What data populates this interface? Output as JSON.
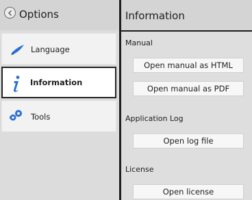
{
  "sidebar": {
    "title": "Options",
    "items": [
      {
        "label": "Language",
        "icon": "brush-icon",
        "selected": false
      },
      {
        "label": "Information",
        "icon": "info-icon",
        "selected": true
      },
      {
        "label": "Tools",
        "icon": "tools-icon",
        "selected": false
      }
    ]
  },
  "content": {
    "title": "Information",
    "sections": [
      {
        "label": "Manual",
        "buttons": [
          "Open manual as HTML",
          "Open manual as PDF"
        ]
      },
      {
        "label": "Application Log",
        "buttons": [
          "Open log file"
        ]
      },
      {
        "label": "License",
        "buttons": [
          "Open license"
        ]
      }
    ]
  },
  "colors": {
    "accent_blue": "#2a6fd6",
    "sidebar_bg": "#dcdcdc",
    "content_bg": "#dedede",
    "selected_border": "#222222"
  }
}
